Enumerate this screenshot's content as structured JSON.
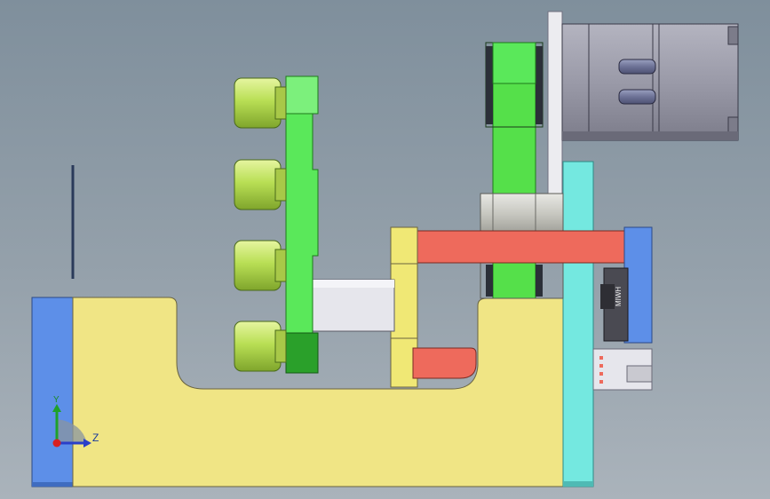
{
  "viewport": {
    "background_top": "#7f8f9c",
    "background_bottom": "#aab3bb"
  },
  "parts": {
    "base": {
      "color": "#f0e585",
      "edge": "#5a5a40"
    },
    "left_plate": {
      "color": "#5d8fe8"
    },
    "right_plate": {
      "color": "#74e8e0"
    },
    "green_arm": {
      "color": "#5ae85a",
      "dark": "#2aa02a"
    },
    "green_belt": {
      "color": "#55e04a"
    },
    "pulley": {
      "color": "#c9c9c4"
    },
    "red_bar": {
      "color": "#ee6a5c"
    },
    "yellow_block": {
      "color": "#f0e875"
    },
    "motor": {
      "color": "#9a9aa6"
    },
    "rollers": {
      "color": "#c6e66a",
      "count": 4
    },
    "rail_block": {
      "label": "MIWH"
    }
  },
  "triad": {
    "x_axis_label": "Z",
    "y_axis_label": "Y"
  }
}
